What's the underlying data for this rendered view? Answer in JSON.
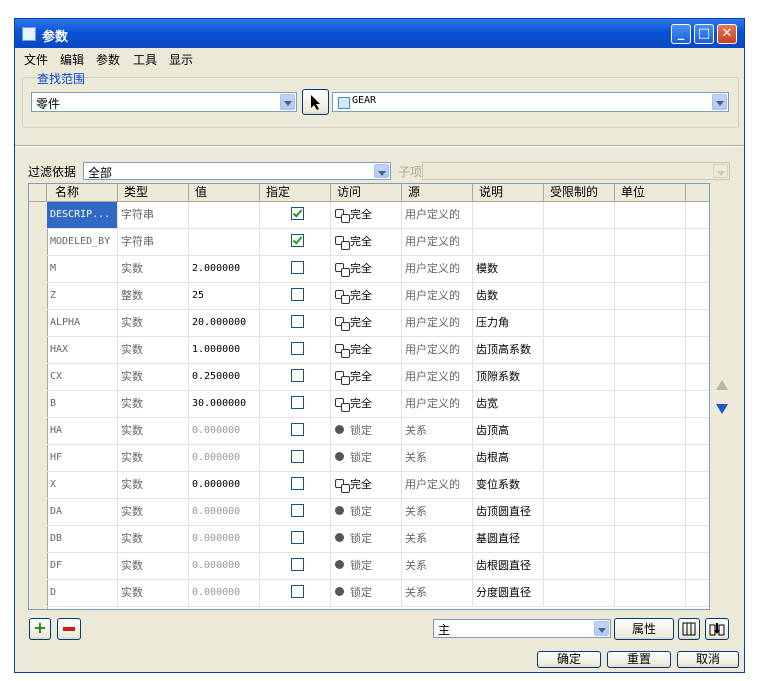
{
  "window": {
    "title": "参数"
  },
  "menu": [
    "文件",
    "编辑",
    "参数",
    "工具",
    "显示"
  ],
  "scope": {
    "legend": "查找范围",
    "type_value": "零件",
    "object_value": "GEAR"
  },
  "filter": {
    "label": "过滤依据",
    "value": "全部",
    "sub_label": "子项",
    "sub_value": ""
  },
  "table": {
    "headers": [
      "名称",
      "类型",
      "值",
      "指定",
      "访问",
      "源",
      "说明",
      "受限制的",
      "单位"
    ],
    "rows": [
      {
        "name": "DESCRIP...",
        "type": "字符串",
        "value": "",
        "designated": true,
        "access": "完全",
        "source": "用户定义的",
        "desc": ""
      },
      {
        "name": "MODELED_BY",
        "type": "字符串",
        "value": "",
        "designated": true,
        "access": "完全",
        "source": "用户定义的",
        "desc": ""
      },
      {
        "name": "M",
        "type": "实数",
        "value": "2.000000",
        "designated": false,
        "access": "完全",
        "source": "用户定义的",
        "desc": "模数"
      },
      {
        "name": "Z",
        "type": "整数",
        "value": "25",
        "designated": false,
        "access": "完全",
        "source": "用户定义的",
        "desc": "齿数"
      },
      {
        "name": "ALPHA",
        "type": "实数",
        "value": "20.000000",
        "designated": false,
        "access": "完全",
        "source": "用户定义的",
        "desc": "压力角"
      },
      {
        "name": "HAX",
        "type": "实数",
        "value": "1.000000",
        "designated": false,
        "access": "完全",
        "source": "用户定义的",
        "desc": "齿顶高系数"
      },
      {
        "name": "CX",
        "type": "实数",
        "value": "0.250000",
        "designated": false,
        "access": "完全",
        "source": "用户定义的",
        "desc": "顶隙系数"
      },
      {
        "name": "B",
        "type": "实数",
        "value": "30.000000",
        "designated": false,
        "access": "完全",
        "source": "用户定义的",
        "desc": "齿宽"
      },
      {
        "name": "HA",
        "type": "实数",
        "value": "0.000000",
        "designated": false,
        "access": "锁定",
        "source": "关系",
        "desc": "齿顶高"
      },
      {
        "name": "HF",
        "type": "实数",
        "value": "0.000000",
        "designated": false,
        "access": "锁定",
        "source": "关系",
        "desc": "齿根高"
      },
      {
        "name": "X",
        "type": "实数",
        "value": "0.000000",
        "designated": false,
        "access": "完全",
        "source": "用户定义的",
        "desc": "变位系数"
      },
      {
        "name": "DA",
        "type": "实数",
        "value": "0.000000",
        "designated": false,
        "access": "锁定",
        "source": "关系",
        "desc": "齿顶圆直径"
      },
      {
        "name": "DB",
        "type": "实数",
        "value": "0.000000",
        "designated": false,
        "access": "锁定",
        "source": "关系",
        "desc": "基圆直径"
      },
      {
        "name": "DF",
        "type": "实数",
        "value": "0.000000",
        "designated": false,
        "access": "锁定",
        "source": "关系",
        "desc": "齿根圆直径"
      },
      {
        "name": "D",
        "type": "实数",
        "value": "0.000000",
        "designated": false,
        "access": "锁定",
        "source": "关系",
        "desc": "分度圆直径"
      }
    ]
  },
  "bottom": {
    "main_value": "主",
    "properties_label": "属性",
    "ok_label": "确定",
    "reset_label": "重置",
    "cancel_label": "取消"
  },
  "colors": {
    "title_bar": "#0a52d6",
    "selection": "#316ac5",
    "legend_text": "#0046d5"
  }
}
